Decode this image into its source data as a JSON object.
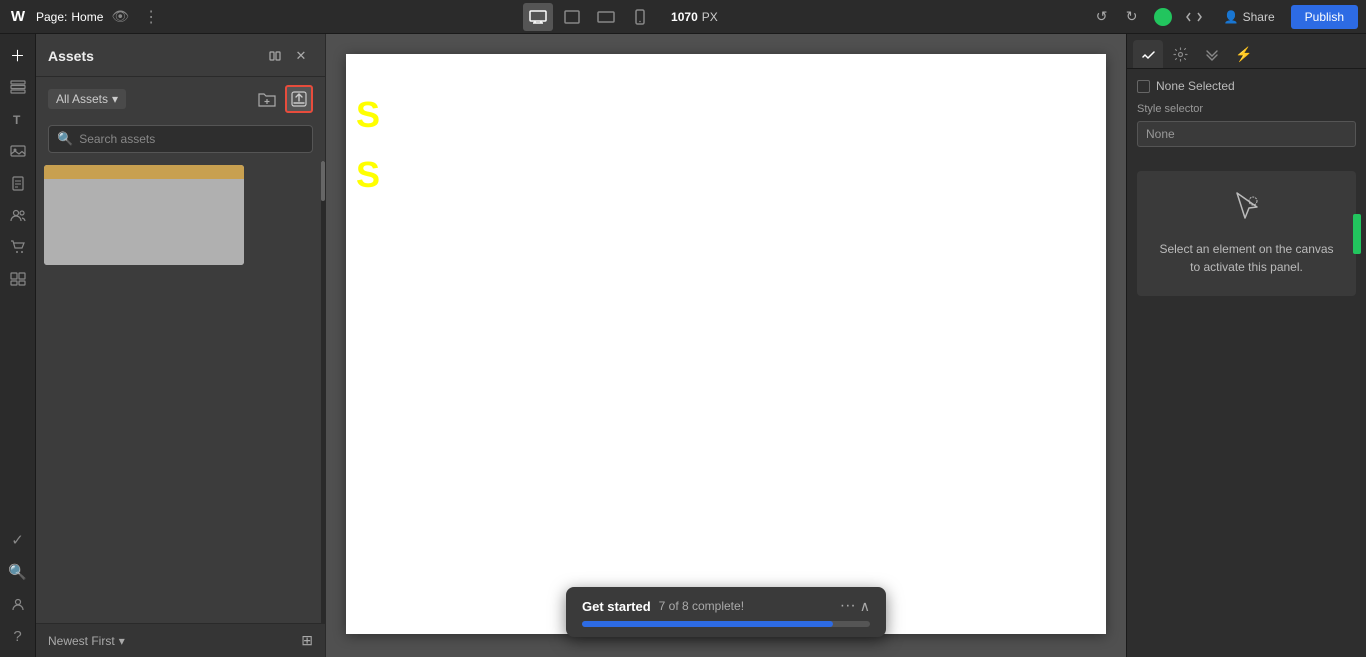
{
  "topbar": {
    "logo": "W",
    "page_label": "Page:",
    "page_name": "Home",
    "width_value": "1070",
    "width_unit": "PX",
    "publish_label": "Publish",
    "share_label": "Share",
    "tools": [
      {
        "id": "desktop",
        "icon": "🖥",
        "active": true
      },
      {
        "id": "frame1",
        "icon": "⬜",
        "active": false
      },
      {
        "id": "frame2",
        "icon": "▭",
        "active": false
      },
      {
        "id": "mobile",
        "icon": "📱",
        "active": false
      }
    ]
  },
  "assets_panel": {
    "title": "Assets",
    "all_assets_label": "All Assets",
    "search_placeholder": "Search assets",
    "newest_first_label": "Newest First",
    "none_selected_label": "None Selected"
  },
  "right_panel": {
    "style_selector_label": "Style selector",
    "none_value": "None",
    "activate_text": "Select an element on the canvas to activate this panel."
  },
  "get_started": {
    "title": "Get started",
    "progress_text": "7 of 8 complete!",
    "progress_percent": 87
  }
}
